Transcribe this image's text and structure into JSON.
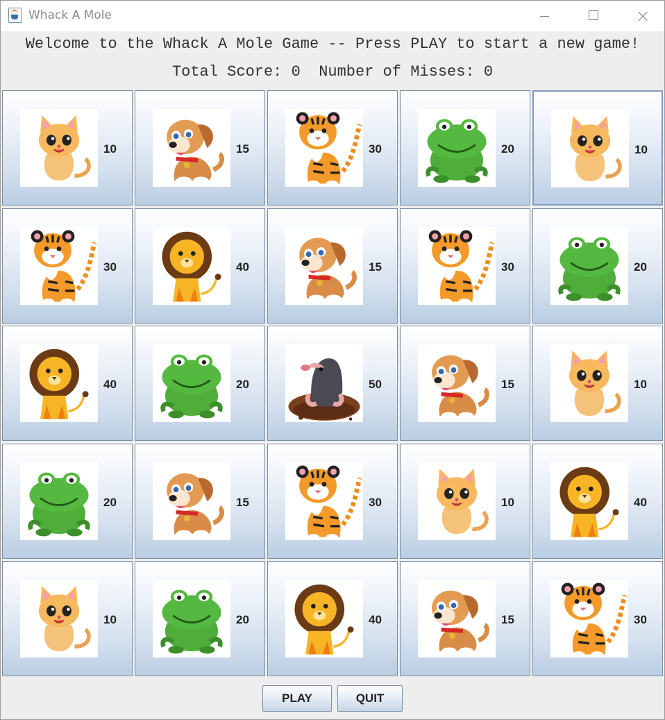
{
  "window": {
    "title": "Whack A Mole"
  },
  "header": {
    "welcome": "Welcome to the Whack A Mole Game -- Press PLAY to start a new game!",
    "score_line": "Total Score: 0  Number of Misses: 0"
  },
  "grid": {
    "rows": [
      [
        {
          "animal": "cat",
          "points": "10"
        },
        {
          "animal": "dog",
          "points": "15"
        },
        {
          "animal": "tiger",
          "points": "30"
        },
        {
          "animal": "frog",
          "points": "20"
        },
        {
          "animal": "cat",
          "points": "10"
        }
      ],
      [
        {
          "animal": "tiger",
          "points": "30"
        },
        {
          "animal": "lion",
          "points": "40"
        },
        {
          "animal": "dog",
          "points": "15"
        },
        {
          "animal": "tiger",
          "points": "30"
        },
        {
          "animal": "frog",
          "points": "20"
        }
      ],
      [
        {
          "animal": "lion",
          "points": "40"
        },
        {
          "animal": "frog",
          "points": "20"
        },
        {
          "animal": "mole",
          "points": "50"
        },
        {
          "animal": "dog",
          "points": "15"
        },
        {
          "animal": "cat",
          "points": "10"
        }
      ],
      [
        {
          "animal": "frog",
          "points": "20"
        },
        {
          "animal": "dog",
          "points": "15"
        },
        {
          "animal": "tiger",
          "points": "30"
        },
        {
          "animal": "cat",
          "points": "10"
        },
        {
          "animal": "lion",
          "points": "40"
        }
      ],
      [
        {
          "animal": "cat",
          "points": "10"
        },
        {
          "animal": "frog",
          "points": "20"
        },
        {
          "animal": "lion",
          "points": "40"
        },
        {
          "animal": "dog",
          "points": "15"
        },
        {
          "animal": "tiger",
          "points": "30"
        }
      ]
    ]
  },
  "buttons": {
    "play": "PLAY",
    "quit": "QUIT"
  }
}
